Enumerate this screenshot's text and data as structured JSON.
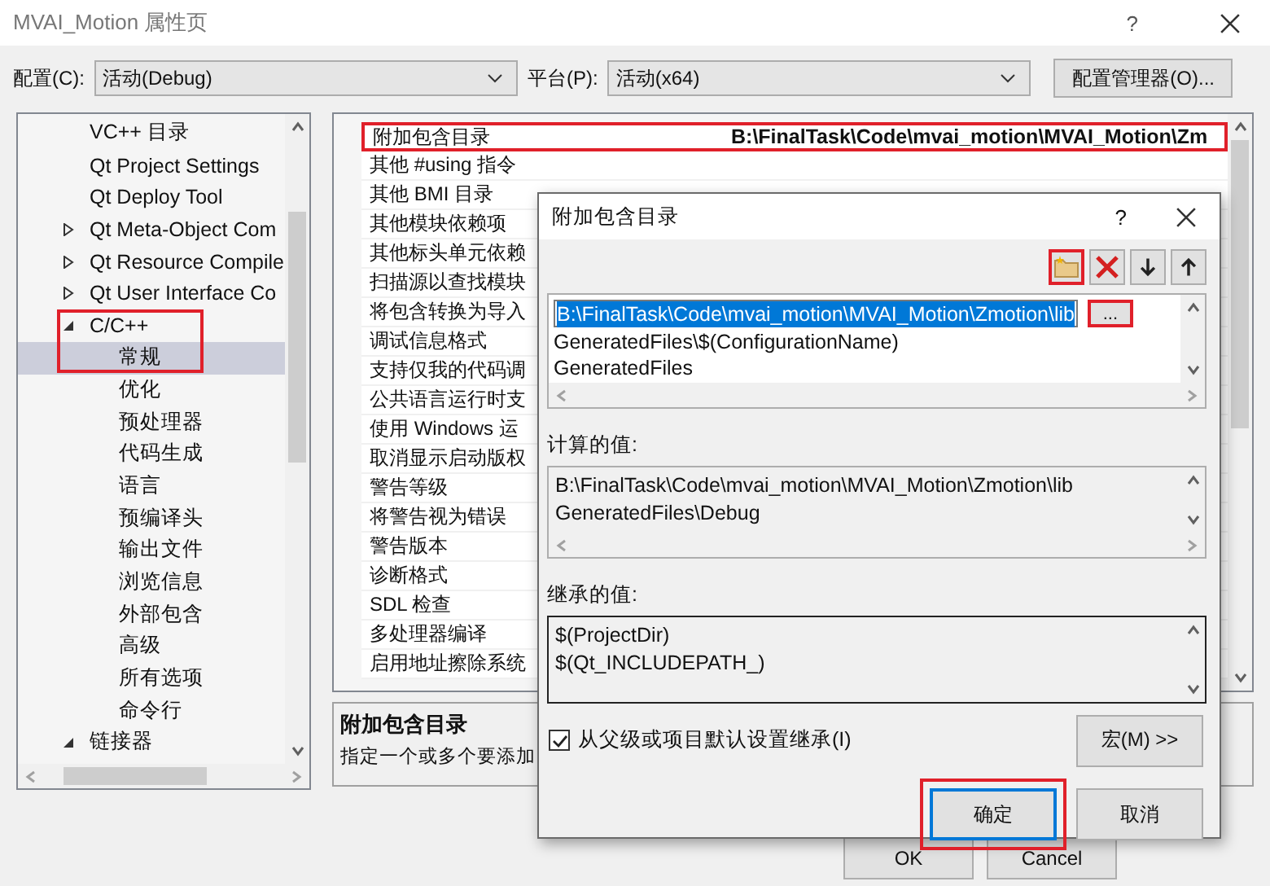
{
  "window": {
    "title": "MVAI_Motion 属性页",
    "help": "?"
  },
  "config": {
    "label": "配置(C):",
    "value": "活动(Debug)"
  },
  "platform": {
    "label": "平台(P):",
    "value": "活动(x64)"
  },
  "config_manager_button": "配置管理器(O)...",
  "tree": [
    {
      "label": "VC++ 目录",
      "selected": false,
      "highlighted": false
    },
    {
      "label": "Qt Project Settings",
      "selected": false,
      "highlighted": false
    },
    {
      "label": "Qt Deploy Tool",
      "selected": false,
      "highlighted": false
    },
    {
      "label": "Qt Meta-Object Com",
      "selected": false,
      "expanded": false,
      "highlighted": false
    },
    {
      "label": "Qt Resource Compile",
      "selected": false,
      "expanded": false,
      "highlighted": false
    },
    {
      "label": "Qt User Interface Co",
      "selected": false,
      "expanded": false,
      "highlighted": false
    },
    {
      "label": "C/C++",
      "selected": false,
      "expanded": true,
      "highlighted": true,
      "children": [
        {
          "label": "常规",
          "selected": true
        },
        {
          "label": "优化",
          "selected": false
        },
        {
          "label": "预处理器",
          "selected": false
        },
        {
          "label": "代码生成",
          "selected": false
        },
        {
          "label": "语言",
          "selected": false
        },
        {
          "label": "预编译头",
          "selected": false
        },
        {
          "label": "输出文件",
          "selected": false
        },
        {
          "label": "浏览信息",
          "selected": false
        },
        {
          "label": "外部包含",
          "selected": false
        },
        {
          "label": "高级",
          "selected": false
        },
        {
          "label": "所有选项",
          "selected": false
        },
        {
          "label": "命令行",
          "selected": false
        }
      ]
    },
    {
      "label": "链接器",
      "selected": false,
      "expanded": true,
      "highlighted": false
    }
  ],
  "properties": [
    {
      "name": "附加包含目录",
      "value": "B:\\FinalTask\\Code\\mvai_motion\\MVAI_Motion\\Zm",
      "highlighted": true
    },
    {
      "name": "其他 #using 指令",
      "highlighted": false
    },
    {
      "name": "其他 BMI 目录",
      "highlighted": false
    },
    {
      "name": "其他模块依赖项",
      "highlighted": false
    },
    {
      "name": "其他标头单元依赖",
      "highlighted": false
    },
    {
      "name": "扫描源以查找模块",
      "highlighted": false
    },
    {
      "name": "将包含转换为导入",
      "highlighted": false
    },
    {
      "name": "调试信息格式",
      "highlighted": false
    },
    {
      "name": "支持仅我的代码调",
      "highlighted": false
    },
    {
      "name": "公共语言运行时支",
      "highlighted": false
    },
    {
      "name": "使用 Windows 运",
      "highlighted": false
    },
    {
      "name": "取消显示启动版权",
      "highlighted": false
    },
    {
      "name": "警告等级",
      "highlighted": false
    },
    {
      "name": "将警告视为错误",
      "highlighted": false
    },
    {
      "name": "警告版本",
      "highlighted": false
    },
    {
      "name": "诊断格式",
      "highlighted": false
    },
    {
      "name": "SDL 检查",
      "highlighted": false
    },
    {
      "name": "多处理器编译",
      "highlighted": false
    },
    {
      "name": "启用地址擦除系统",
      "highlighted": false
    }
  ],
  "description": {
    "title": "附加包含目录",
    "text": "指定一个或多个要添加"
  },
  "footer_buttons": [
    "OK",
    "Cancel"
  ],
  "dialog": {
    "title": "附加包含目录",
    "help": "?",
    "toolbar": [
      {
        "kind": "new-folder",
        "highlighted": true
      },
      {
        "kind": "delete",
        "highlighted": false
      },
      {
        "kind": "move-down",
        "highlighted": false
      },
      {
        "kind": "move-up",
        "highlighted": false
      }
    ],
    "entries": [
      {
        "text": "B:\\FinalTask\\Code\\mvai_motion\\MVAI_Motion\\Zmotion\\lib",
        "selected": true
      },
      {
        "text": "GeneratedFiles\\$(ConfigurationName)",
        "selected": false
      },
      {
        "text": "GeneratedFiles",
        "selected": false
      }
    ],
    "browse_button": {
      "label": "...",
      "highlighted": true
    },
    "evaluated": {
      "label": "计算的值:",
      "lines": [
        "B:\\FinalTask\\Code\\mvai_motion\\MVAI_Motion\\Zmotion\\lib",
        "GeneratedFiles\\Debug"
      ]
    },
    "inherited": {
      "label": "继承的值:",
      "lines": [
        "$(ProjectDir)",
        "$(Qt_INCLUDEPATH_)"
      ]
    },
    "inherit_checkbox": {
      "label": "从父级或项目默认设置继承(I)",
      "checked": true
    },
    "macros_button": "宏(M) >>",
    "ok_button": {
      "label": "确定",
      "highlighted": true
    },
    "cancel_button": "取消"
  }
}
